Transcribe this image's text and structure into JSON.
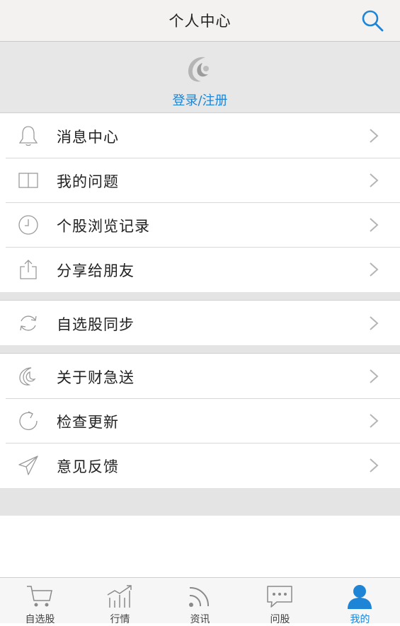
{
  "header": {
    "title": "个人中心",
    "search_icon": "search-icon"
  },
  "login": {
    "logo_icon": "app-logo",
    "link": "登录/注册"
  },
  "groups": [
    {
      "items": [
        {
          "label": "消息中心",
          "icon": "bell-icon"
        },
        {
          "label": "我的问题",
          "icon": "book-icon"
        },
        {
          "label": "个股浏览记录",
          "icon": "clock-icon"
        },
        {
          "label": "分享给朋友",
          "icon": "share-icon"
        }
      ]
    },
    {
      "items": [
        {
          "label": "自选股同步",
          "icon": "sync-icon"
        }
      ]
    },
    {
      "items": [
        {
          "label": "关于财急送",
          "icon": "app-logo-icon"
        },
        {
          "label": "检查更新",
          "icon": "refresh-icon"
        },
        {
          "label": "意见反馈",
          "icon": "paper-plane-icon"
        }
      ]
    }
  ],
  "tabs": [
    {
      "label": "自选股",
      "icon": "cart-icon"
    },
    {
      "label": "行情",
      "icon": "chart-icon"
    },
    {
      "label": "资讯",
      "icon": "rss-icon"
    },
    {
      "label": "问股",
      "icon": "chat-icon"
    },
    {
      "label": "我的",
      "icon": "user-icon",
      "active": true
    }
  ],
  "colors": {
    "accent": "#1d84d6",
    "icon_gray": "#9a9a9a"
  }
}
